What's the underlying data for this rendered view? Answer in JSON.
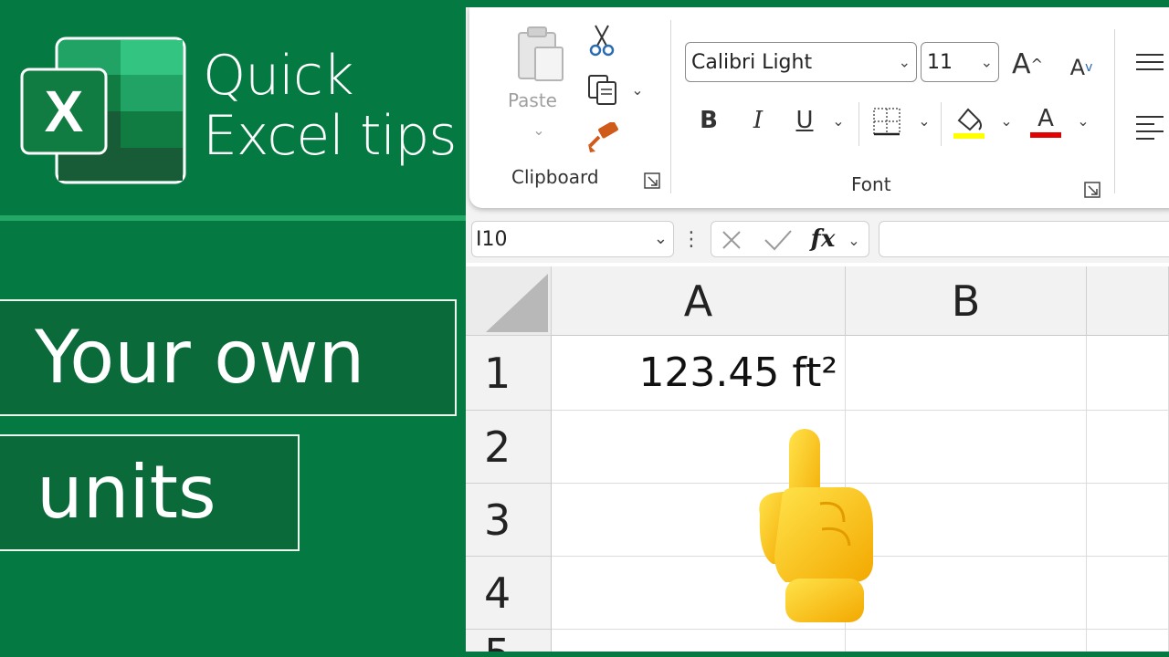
{
  "brand": {
    "logo_letter": "X",
    "title_line1": "Quick",
    "title_line2": "Excel tips"
  },
  "captions": [
    "Your own",
    "units"
  ],
  "ribbon": {
    "clipboard": {
      "paste_label": "Paste",
      "group_label": "Clipboard"
    },
    "font": {
      "font_name": "Calibri Light",
      "font_size": "11",
      "bold_label": "B",
      "italic_label": "I",
      "underline_label": "U",
      "grow_label": "A",
      "shrink_label": "A",
      "font_color_label": "A",
      "group_label": "Font",
      "highlight_color": "#ffff00",
      "font_color": "#e00000"
    }
  },
  "formula_bar": {
    "name_box": "I10",
    "fx_label": "fx",
    "formula": ""
  },
  "sheet": {
    "columns": [
      "A",
      "B"
    ],
    "rows": [
      "1",
      "2",
      "3",
      "4",
      "5"
    ],
    "cells": {
      "A1": "123.45 ft²"
    }
  },
  "colors": {
    "brand_green": "#047a42",
    "caption_green": "#0b6a3a"
  }
}
